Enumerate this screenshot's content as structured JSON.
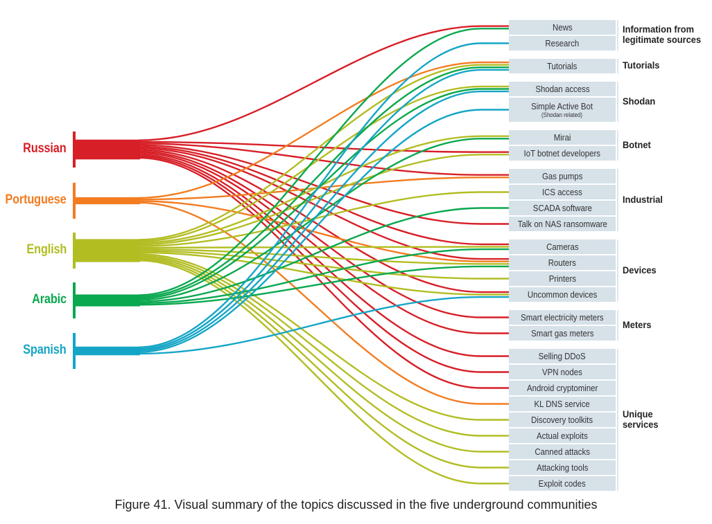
{
  "chart_data": {
    "type": "diagram",
    "title": "Figure 41. Visual summary of the topics discussed in the five underground communities",
    "languages": [
      {
        "name": "Russian",
        "color": "#d71f27"
      },
      {
        "name": "Portuguese",
        "color": "#f37c20"
      },
      {
        "name": "English",
        "color": "#b2bd22"
      },
      {
        "name": "Arabic",
        "color": "#0aa84f"
      },
      {
        "name": "Spanish",
        "color": "#14a5c6"
      }
    ],
    "groups": [
      {
        "label": "Information from legitimate sources",
        "topics": [
          {
            "label": "News",
            "languages": [
              "Russian",
              "Arabic"
            ]
          },
          {
            "label": "Research",
            "languages": [
              "Spanish"
            ]
          }
        ]
      },
      {
        "label": "Tutorials",
        "topics": [
          {
            "label": "Tutorials",
            "languages": [
              "Portuguese",
              "English",
              "Arabic",
              "Spanish"
            ]
          }
        ]
      },
      {
        "label": "Shodan",
        "topics": [
          {
            "label": "Shodan access",
            "languages": [
              "English",
              "Arabic",
              "Spanish"
            ]
          },
          {
            "label": "Simple Active Bot",
            "sublabel": "(Shodan related)",
            "languages": [
              "Spanish"
            ]
          }
        ]
      },
      {
        "label": "Botnet",
        "topics": [
          {
            "label": "Mirai",
            "languages": [
              "English",
              "Arabic"
            ]
          },
          {
            "label": "IoT botnet developers",
            "languages": [
              "Russian",
              "English"
            ]
          }
        ]
      },
      {
        "label": "Industrial",
        "topics": [
          {
            "label": "Gas pumps",
            "languages": [
              "Russian",
              "Portuguese"
            ]
          },
          {
            "label": "ICS access",
            "languages": [
              "English"
            ]
          },
          {
            "label": "SCADA software",
            "languages": [
              "Arabic"
            ]
          },
          {
            "label": "Talk on NAS ransomware",
            "languages": [
              "Russian"
            ]
          }
        ]
      },
      {
        "label": "Devices",
        "topics": [
          {
            "label": "Cameras",
            "languages": [
              "Russian",
              "English",
              "Arabic"
            ]
          },
          {
            "label": "Routers",
            "languages": [
              "Russian",
              "Portuguese",
              "English",
              "Arabic"
            ]
          },
          {
            "label": "Printers",
            "languages": [
              "English"
            ]
          },
          {
            "label": "Uncommon devices",
            "languages": [
              "Russian",
              "English",
              "Spanish"
            ]
          }
        ]
      },
      {
        "label": "Meters",
        "topics": [
          {
            "label": "Smart electricity meters",
            "languages": [
              "Russian"
            ]
          },
          {
            "label": "Smart gas meters",
            "languages": [
              "Russian"
            ]
          }
        ]
      },
      {
        "label": "Unique services",
        "topics": [
          {
            "label": "Selling DDoS",
            "languages": [
              "Russian"
            ]
          },
          {
            "label": "VPN nodes",
            "languages": [
              "Russian"
            ]
          },
          {
            "label": "Android cryptominer",
            "languages": [
              "Russian"
            ]
          },
          {
            "label": "KL DNS service",
            "languages": [
              "Portuguese"
            ]
          },
          {
            "label": "Discovery toolkits",
            "languages": [
              "English"
            ]
          },
          {
            "label": "Actual exploits",
            "languages": [
              "English"
            ]
          },
          {
            "label": "Canned attacks",
            "languages": [
              "English"
            ]
          },
          {
            "label": "Attacking tools",
            "languages": [
              "English"
            ]
          },
          {
            "label": "Exploit codes",
            "languages": [
              "English"
            ]
          }
        ]
      }
    ]
  },
  "caption": "Figure 41. Visual summary of the topics discussed in the five underground communities"
}
